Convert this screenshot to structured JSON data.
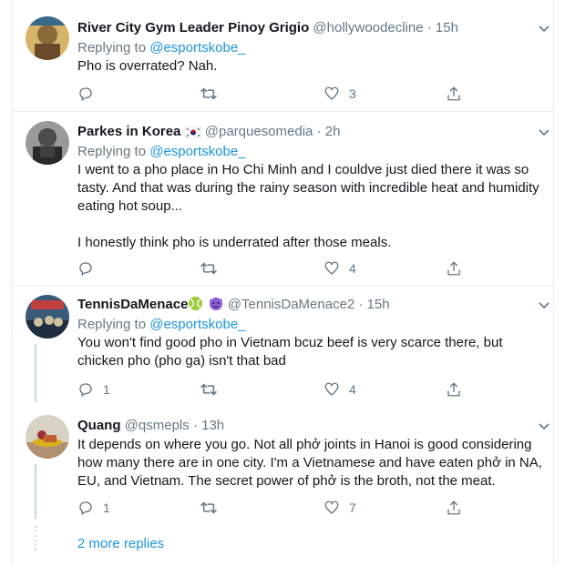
{
  "tweets": [
    {
      "name": "River City Gym Leader Pinoy Grigio",
      "handle": "@hollywoodecline",
      "sep": "·",
      "time": "15h",
      "replying_prefix": "Replying to",
      "replying_to": "@esportskobe_",
      "lines": [
        "Pho is overrated? Nah."
      ],
      "replies": "",
      "likes": "3",
      "avatar_color": "#8a6a3a"
    },
    {
      "name": "Parkes in Korea",
      "flag": "🇰🇷",
      "handle": "@parquesomedia",
      "sep": "·",
      "time": "2h",
      "replying_prefix": "Replying to",
      "replying_to": "@esportskobe_",
      "lines": [
        "I went to a pho place in Ho Chi Minh and I couldve just died there it was so",
        "tasty. And that was during the rainy season with incredible heat and humidity",
        "eating hot soup..."
      ],
      "lines2": [
        "I honestly think pho is underrated after those meals."
      ],
      "replies": "",
      "likes": "4",
      "avatar_color": "#5c5c5c"
    },
    {
      "name": "TennisDaMenace",
      "handle": "@TennisDaMenace2",
      "sep": "·",
      "time": "15h",
      "replying_prefix": "Replying to",
      "replying_to": "@esportskobe_",
      "lines": [
        "You won't find good pho in Vietnam bcuz beef is very scarce there, but",
        "chicken pho (pho ga) isn't that bad"
      ],
      "replies": "1",
      "likes": "4",
      "avatar_color": "#2f4a6b"
    },
    {
      "name": "Quang",
      "handle": "@qsmepls",
      "sep": "·",
      "time": "13h",
      "lines": [
        "It depends on where you go. Not all phở joints in Hanoi is good considering",
        "how many there are in one city. I'm a Vietnamese and have eaten phở in NA,",
        "EU, and Vietnam. The secret power of phở is the broth, not the meat."
      ],
      "replies": "1",
      "likes": "7",
      "avatar_color": "#b5a98f"
    }
  ],
  "more_replies": "2 more replies",
  "icons": {
    "reply": "reply-icon",
    "retweet": "retweet-icon",
    "like": "heart-icon",
    "share": "share-icon",
    "caret": "chevron-down-icon"
  },
  "colors": {
    "link": "#1b95e0",
    "muted": "#657786",
    "border": "#e6ecf0"
  }
}
